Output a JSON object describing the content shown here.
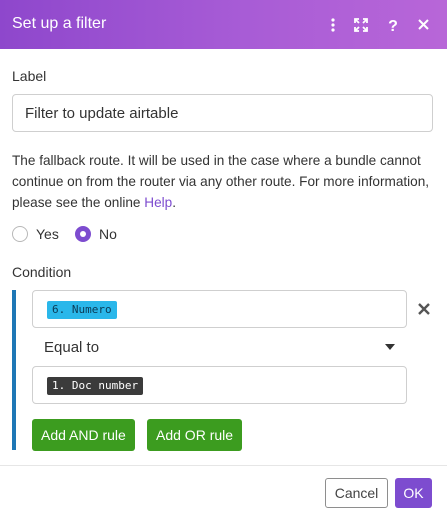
{
  "header": {
    "title": "Set up a filter",
    "icons": [
      "kebab-menu-icon",
      "expand-icon",
      "help-icon",
      "close-icon"
    ],
    "background": "#9a4fd1"
  },
  "label_field": {
    "label": "Label",
    "value": "Filter to update airtable"
  },
  "fallback": {
    "description": "The fallback route. It will be used in the case where a bundle cannot continue on from the router via any other route. For more information, please see the online ",
    "help_link": "Help",
    "period": ".",
    "options": [
      {
        "label": "Yes",
        "checked": false
      },
      {
        "label": "No",
        "checked": true
      }
    ]
  },
  "condition": {
    "label": "Condition",
    "left_operand": "6. Numero",
    "operator": "Equal to",
    "right_operand": "1. Doc number",
    "add_and_label": "Add AND rule",
    "add_or_label": "Add OR rule"
  },
  "footer": {
    "cancel_label": "Cancel",
    "ok_label": "OK"
  },
  "colors": {
    "accent": "#7d4ccf",
    "green": "#3c9c1f",
    "condition_bar": "#1e77b6",
    "pill_blue": "#2ab7ea",
    "pill_dark": "#3b3b3b"
  }
}
